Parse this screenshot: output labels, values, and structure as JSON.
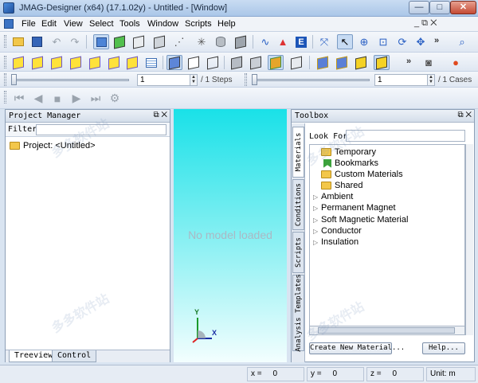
{
  "window": {
    "title": "JMAG-Designer (x64) (17.1.02y) - Untitled - [Window]",
    "minimize_glyph": "—",
    "maximize_glyph": "□",
    "close_glyph": "✕"
  },
  "menu": {
    "items": [
      "File",
      "Edit",
      "View",
      "Select",
      "Tools",
      "Window",
      "Scripts",
      "Help"
    ],
    "right_controls": "_ ⧉ ✕"
  },
  "toolbar": {
    "overflow_glyph": "»",
    "tb1_icons": [
      "open-folder-icon",
      "save-icon",
      "undo-icon",
      "redo-icon",
      "solid-view-icon",
      "green-cube-icon",
      "box-icon",
      "mesh-icon",
      "spark-icon",
      "cylinder-icon",
      "gray-box-icon",
      "graph-icon",
      "chart-3d-icon",
      "e-icon",
      "fit-icon",
      "pointer-icon",
      "zoom-in-icon",
      "zoom-window-icon",
      "rotate-icon",
      "pan-icon",
      "search-icon"
    ],
    "tb2_icons": [
      "cube-1",
      "cube-2",
      "cube-3",
      "cube-4",
      "cube-5",
      "cube-6",
      "table-icon",
      "cube-blue-icon",
      "cube-white-icon",
      "cube-wire-icon",
      "cube-gray-1",
      "cube-gray-2",
      "cube-layer-icon",
      "cube-outline-icon",
      "cube-blue-2",
      "cube-gold-icon",
      "cube-yellow-icon",
      "camera-icon",
      "record-icon"
    ],
    "steps": {
      "value": "1",
      "total_label": "/ 1 Steps"
    },
    "cases": {
      "value": "1",
      "total_label": "/ 1 Cases"
    },
    "playback_glyphs": [
      "⏮",
      "◀",
      "■",
      "▶",
      "⏭",
      "⚙"
    ]
  },
  "project_manager": {
    "title": "Project Manager",
    "panel_buttons": "⧉ ✕",
    "filter_label": "Filter:",
    "filter_value": "",
    "root_label": "Project: <Untitled>",
    "tabs": [
      "Treeview",
      "Control"
    ]
  },
  "viewport": {
    "placeholder": "No model loaded",
    "axis_y": "Y",
    "axis_x": "X"
  },
  "toolbox": {
    "title": "Toolbox",
    "panel_buttons": "⧉ ✕",
    "side_tabs": [
      "Materials",
      "Conditions",
      "Scripts",
      "Analysis Templates"
    ],
    "look_for_label": "Look For:",
    "look_for_value": "",
    "folders": [
      "Temporary",
      "Bookmarks",
      "Custom Materials",
      "Shared"
    ],
    "categories": [
      "Ambient",
      "Permanent Magnet",
      "Soft Magnetic Material",
      "Conductor",
      "Insulation"
    ],
    "create_button": "Create New Material...",
    "help_button": "Help..."
  },
  "status": {
    "x_label": "x =",
    "x_value": "0",
    "y_label": "y =",
    "y_value": "0",
    "z_label": "z =",
    "z_value": "0",
    "unit": "Unit: m"
  },
  "watermark": "多多软件站"
}
